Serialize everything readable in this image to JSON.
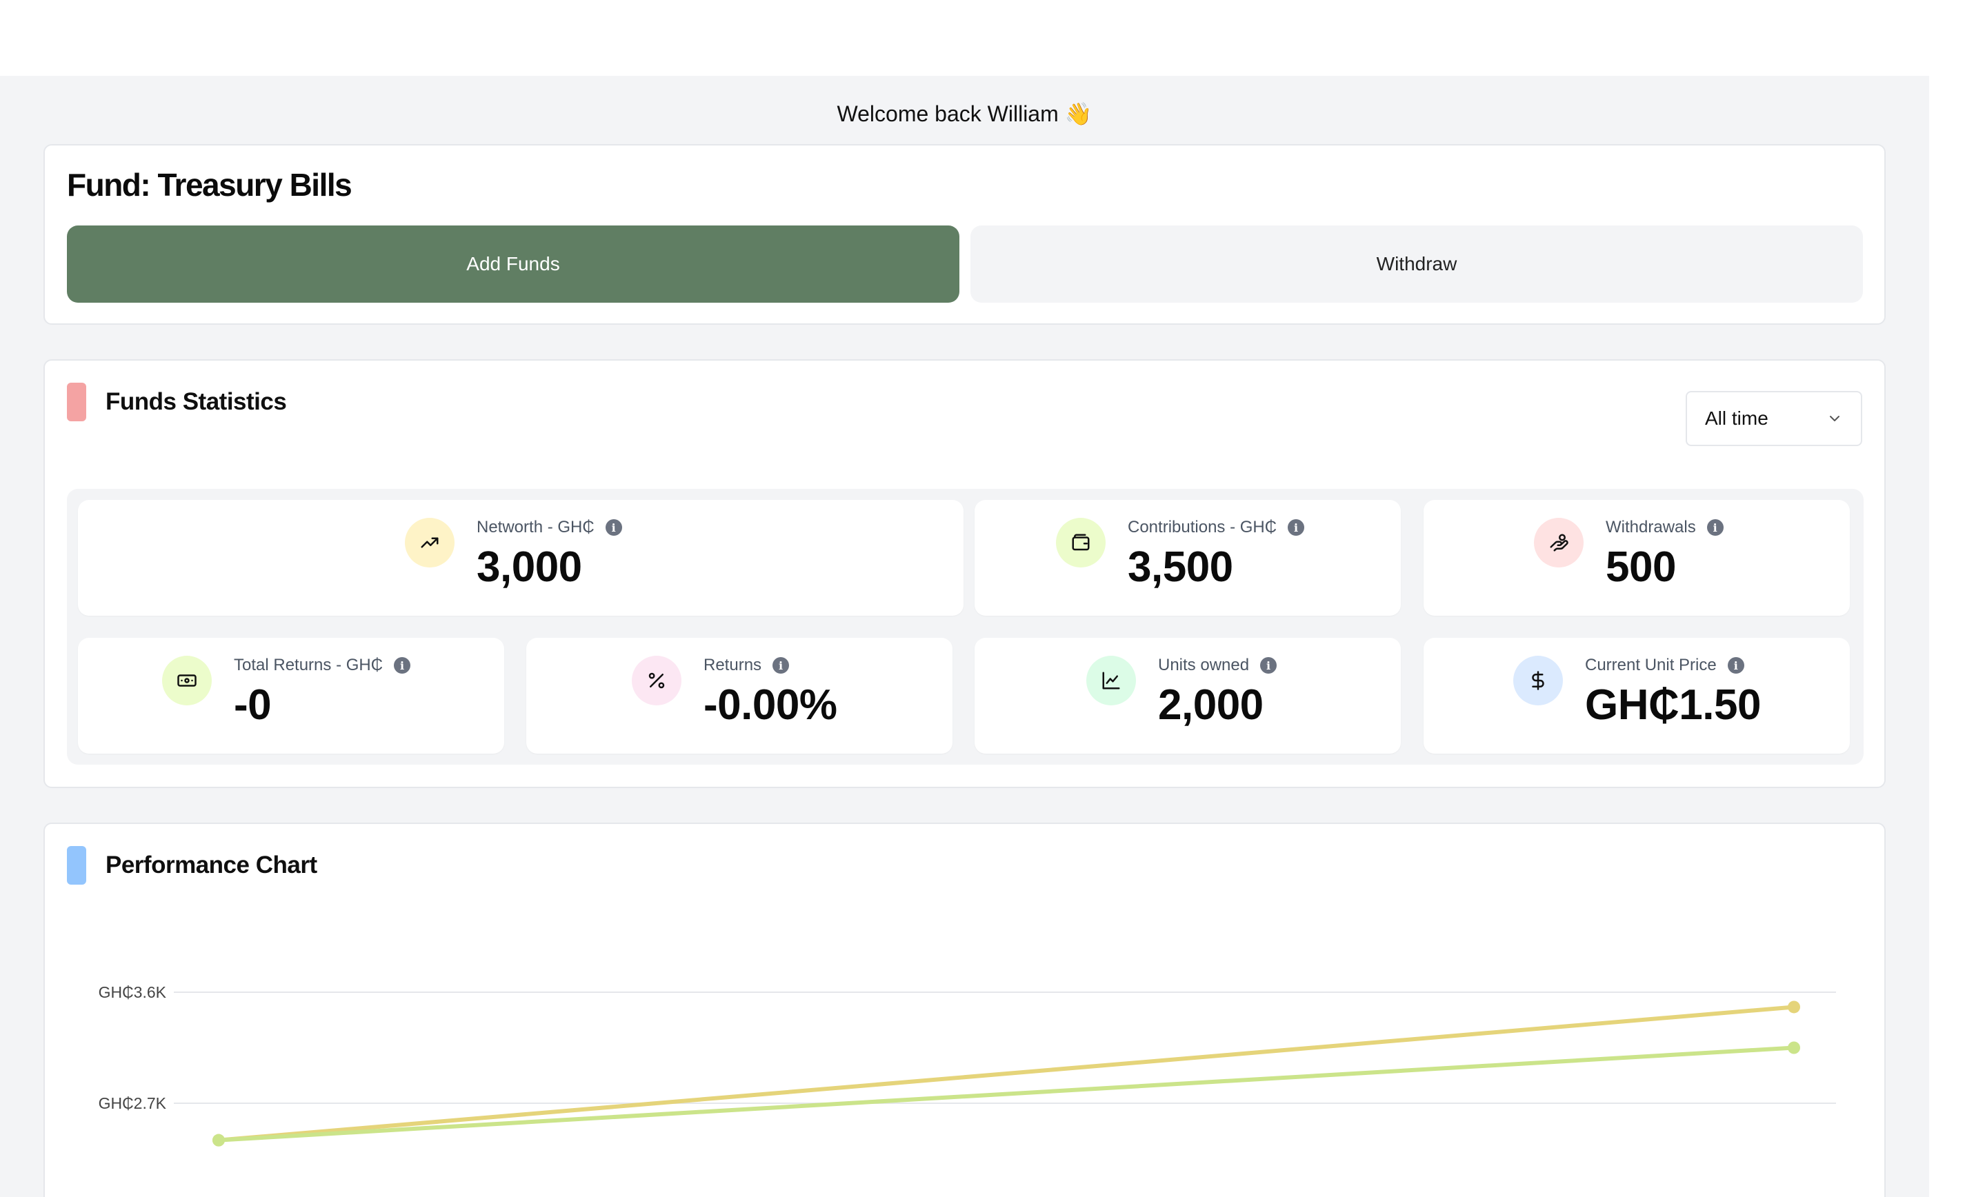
{
  "welcome": "Welcome back William 👋",
  "fund": {
    "title": "Fund: Treasury Bills",
    "add_label": "Add Funds",
    "withdraw_label": "Withdraw"
  },
  "stats": {
    "title": "Funds Statistics",
    "section_color": "#f4a3a3",
    "period": "All time",
    "cards": [
      {
        "label": "Networth - GH₵",
        "value": "3,000",
        "icon": "trending-up-icon",
        "icon_bg": "#fef3c7"
      },
      {
        "label": "Contributions - GH₵",
        "value": "3,500",
        "icon": "wallet-icon",
        "icon_bg": "#ecfccb"
      },
      {
        "label": "Withdrawals",
        "value": "500",
        "icon": "hand-coins-icon",
        "icon_bg": "#fee2e2"
      },
      {
        "label": "Total Returns - GH₵",
        "value": "-0",
        "icon": "banknote-icon",
        "icon_bg": "#ecfccb"
      },
      {
        "label": "Returns",
        "value": "-0.00%",
        "icon": "percent-icon",
        "icon_bg": "#fce7f3"
      },
      {
        "label": "Units owned",
        "value": "2,000",
        "icon": "line-chart-icon",
        "icon_bg": "#dcfce7"
      },
      {
        "label": "Current Unit Price",
        "value": "GH₵1.50",
        "icon": "dollar-icon",
        "icon_bg": "#dbeafe"
      }
    ]
  },
  "performance": {
    "title": "Performance Chart",
    "section_color": "#93c5fd"
  },
  "chart_data": {
    "type": "line",
    "x": [
      0,
      1
    ],
    "series": [
      {
        "values": [
          2400,
          3480
        ],
        "color": "#e5d47a"
      },
      {
        "values": [
          2400,
          3150
        ],
        "color": "#cbe48a"
      }
    ],
    "yticks": [
      {
        "value": 3600,
        "label": "GH₵3.6K"
      },
      {
        "value": 2700,
        "label": "GH₵2.7K"
      }
    ],
    "grid": true
  }
}
